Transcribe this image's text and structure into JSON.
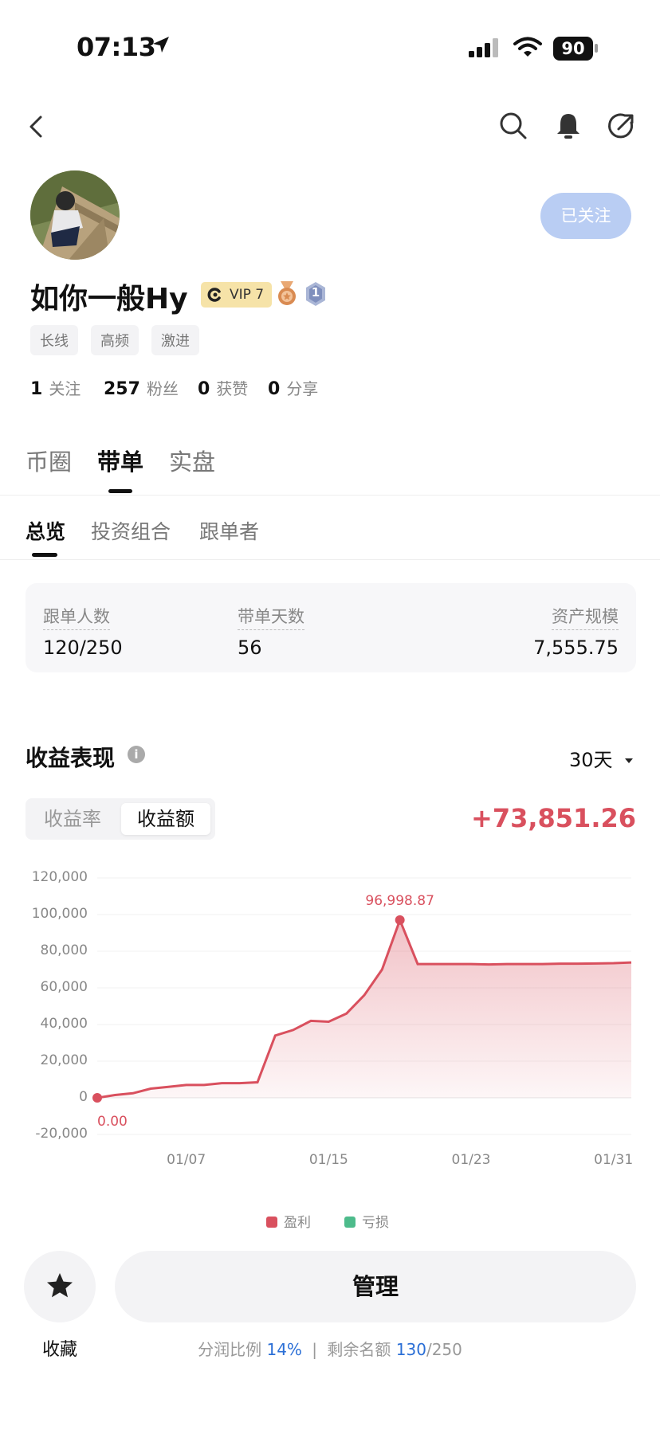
{
  "status_bar": {
    "time": "07:13",
    "battery": "90"
  },
  "profile": {
    "follow_button": "已关注",
    "name": "如你一般Hy",
    "vip_badge": "VIP 7",
    "rank_badge": "1",
    "tags": [
      "长线",
      "高频",
      "激进"
    ],
    "stats": [
      {
        "value": "1",
        "label": "关注"
      },
      {
        "value": "257",
        "label": "粉丝"
      },
      {
        "value": "0",
        "label": "获赞"
      },
      {
        "value": "0",
        "label": "分享"
      }
    ]
  },
  "main_tabs": [
    "币圈",
    "带单",
    "实盘"
  ],
  "sub_tabs": [
    "总览",
    "投资组合",
    "跟单者"
  ],
  "overview": {
    "followers_label": "跟单人数",
    "followers_value": "120/250",
    "days_label": "带单天数",
    "days_value": "56",
    "assets_label": "资产规模",
    "assets_value": "7,555.75"
  },
  "performance": {
    "title": "收益表现",
    "period": "30天",
    "segment_rate": "收益率",
    "segment_amount": "收益额",
    "total": "+73,851.26"
  },
  "colors": {
    "profit": "#d9505e",
    "loss": "#4dbb8b",
    "accent": "#2b6fd6"
  },
  "chart_data": {
    "type": "area",
    "ylim": [
      -20000,
      120000
    ],
    "yticks": [
      "120,000",
      "100,000",
      "80,000",
      "60,000",
      "40,000",
      "20,000",
      "0",
      "-20,000"
    ],
    "xticks": [
      "01/07",
      "01/15",
      "01/23",
      "01/31"
    ],
    "x": [
      "01/02",
      "01/03",
      "01/04",
      "01/05",
      "01/06",
      "01/07",
      "01/08",
      "01/09",
      "01/10",
      "01/11",
      "01/12",
      "01/13",
      "01/14",
      "01/15",
      "01/16",
      "01/17",
      "01/18",
      "01/19",
      "01/20",
      "01/21",
      "01/22",
      "01/23",
      "01/24",
      "01/25",
      "01/26",
      "01/27",
      "01/28",
      "01/29",
      "01/30",
      "01/31",
      "02/01"
    ],
    "values": [
      0,
      1500,
      2500,
      5000,
      6000,
      7000,
      7000,
      8000,
      8000,
      8500,
      34000,
      37000,
      42000,
      41500,
      46000,
      56000,
      70000,
      96998.87,
      73000,
      73000,
      73000,
      73000,
      72800,
      73000,
      73000,
      73000,
      73200,
      73200,
      73300,
      73500,
      73851.26
    ],
    "start_label": "0.00",
    "peak_label": "96,998.87",
    "legend": [
      "盈利",
      "亏损"
    ]
  },
  "bottom_bar": {
    "favorite_label": "收藏",
    "manage_button": "管理",
    "share_label": "分润比例",
    "share_value": "14%",
    "remaining_label": "剩余名额",
    "remaining_value": "130",
    "remaining_total": "/250",
    "separator": "|"
  }
}
